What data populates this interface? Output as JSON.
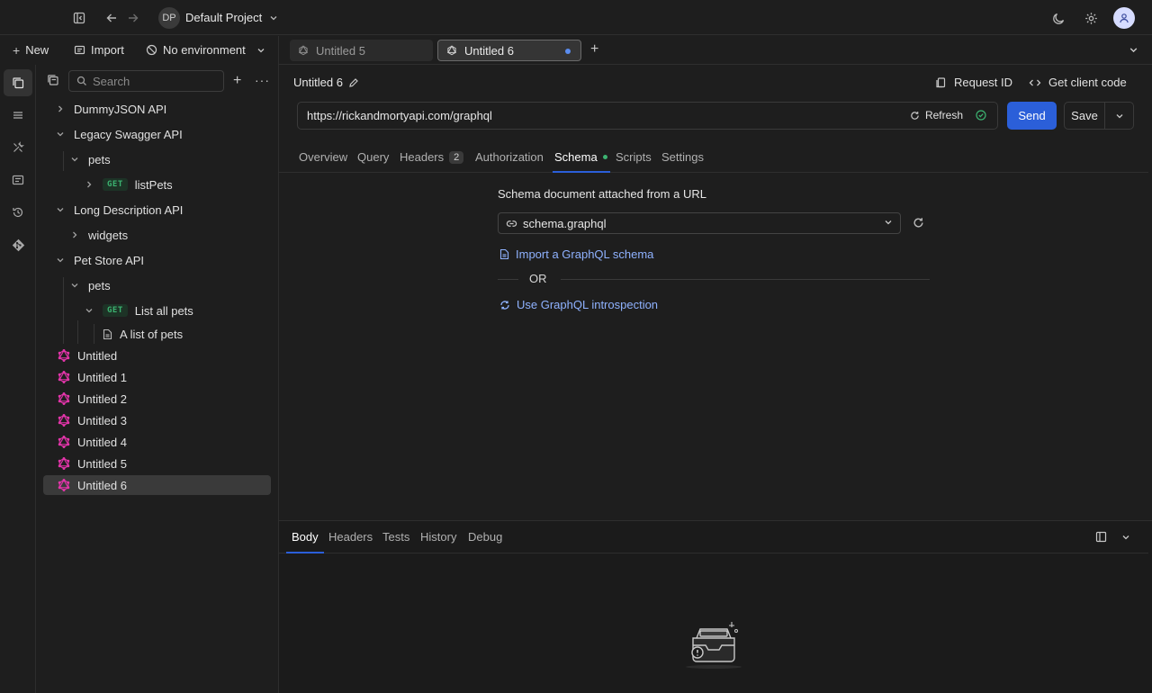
{
  "project": {
    "initials": "DP",
    "name": "Default Project"
  },
  "sidebar": {
    "new_label": "New",
    "import_label": "Import",
    "environment": "No environment",
    "search_placeholder": "Search",
    "tree": [
      {
        "label": "DummyJSON API"
      },
      {
        "label": "Legacy Swagger API"
      },
      {
        "label": "pets"
      },
      {
        "method": "GET",
        "label": "listPets"
      },
      {
        "label": "Long Description API"
      },
      {
        "label": "widgets"
      },
      {
        "label": "Pet Store API"
      },
      {
        "label": "pets"
      },
      {
        "method": "GET",
        "label": "List all pets"
      },
      {
        "label": "A list of pets"
      },
      {
        "label": "Untitled"
      },
      {
        "label": "Untitled 1"
      },
      {
        "label": "Untitled 2"
      },
      {
        "label": "Untitled 3"
      },
      {
        "label": "Untitled 4"
      },
      {
        "label": "Untitled 5"
      },
      {
        "label": "Untitled 6"
      }
    ]
  },
  "tabs": [
    {
      "label": "Untitled 5"
    },
    {
      "label": "Untitled 6"
    }
  ],
  "request": {
    "title": "Untitled 6",
    "request_id_label": "Request ID",
    "client_code_label": "Get client code",
    "url": "https://rickandmortyapi.com/graphql",
    "refresh_label": "Refresh",
    "send_label": "Send",
    "save_label": "Save",
    "subtabs": [
      "Overview",
      "Query",
      "Headers",
      "Authorization",
      "Schema",
      "Scripts",
      "Settings"
    ],
    "headers_count": "2"
  },
  "schema": {
    "description": "Schema document attached from a URL",
    "selected_file": "schema.graphql",
    "import_link": "Import a GraphQL schema",
    "or_label": "OR",
    "introspection_link": "Use GraphQL introspection"
  },
  "response": {
    "tabs": [
      "Body",
      "Headers",
      "Tests",
      "History",
      "Debug"
    ]
  },
  "colors": {
    "accent": "#2b5fd9",
    "link": "#8fb2ff",
    "get_method": "#3cb371",
    "graphql": "#e535ab",
    "background": "#1e1e1e"
  }
}
